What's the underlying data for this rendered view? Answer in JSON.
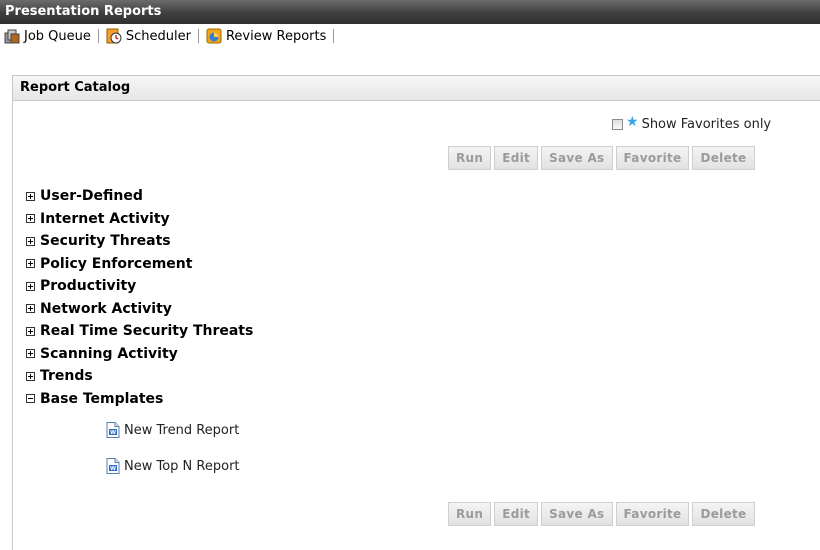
{
  "window": {
    "title": "Presentation Reports"
  },
  "toolbar": {
    "items": [
      {
        "label": "Job Queue",
        "icon": "job-queue-icon"
      },
      {
        "label": "Scheduler",
        "icon": "scheduler-icon"
      },
      {
        "label": "Review Reports",
        "icon": "review-reports-icon"
      }
    ]
  },
  "catalog": {
    "title": "Report Catalog",
    "favorites_label": "Show Favorites only",
    "favorites_checked": false,
    "buttons": [
      "Run",
      "Edit",
      "Save As",
      "Favorite",
      "Delete"
    ],
    "tree": [
      {
        "label": "User-Defined",
        "expanded": false
      },
      {
        "label": "Internet Activity",
        "expanded": false
      },
      {
        "label": "Security Threats",
        "expanded": false
      },
      {
        "label": "Policy Enforcement",
        "expanded": false
      },
      {
        "label": "Productivity",
        "expanded": false
      },
      {
        "label": "Network Activity",
        "expanded": false
      },
      {
        "label": "Real Time Security Threats",
        "expanded": false
      },
      {
        "label": "Scanning Activity",
        "expanded": false
      },
      {
        "label": "Trends",
        "expanded": false
      },
      {
        "label": "Base Templates",
        "expanded": true,
        "children": [
          {
            "label": "New Trend Report",
            "icon": "report-document-icon"
          },
          {
            "label": "New Top N Report",
            "icon": "report-document-icon"
          }
        ]
      }
    ]
  },
  "colors": {
    "titlebar": "#3f3f3f",
    "button_text_disabled": "#9b9b9b",
    "star": "#3aa3e6"
  }
}
